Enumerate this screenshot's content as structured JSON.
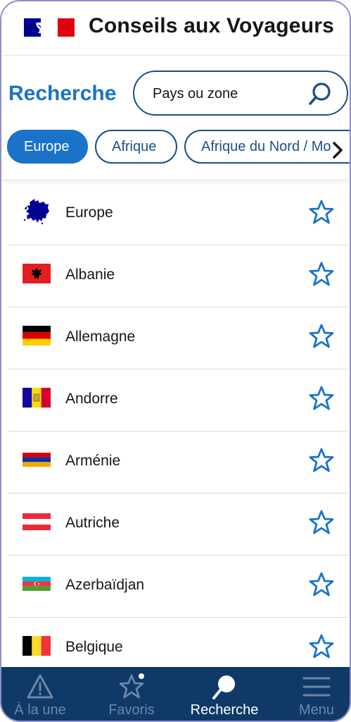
{
  "header": {
    "title": "Conseils aux Voyageurs",
    "colors": {
      "blue": "#000091",
      "red": "#e1000f"
    }
  },
  "search": {
    "heading": "Recherche",
    "placeholder": "Pays ou zone",
    "value": ""
  },
  "chips": [
    {
      "label": "Europe",
      "active": true
    },
    {
      "label": "Afrique",
      "active": false
    },
    {
      "label": "Afrique du Nord / Mo",
      "active": false
    }
  ],
  "countries": [
    {
      "name": "Europe",
      "flag": "europe-map",
      "favorite": false
    },
    {
      "name": "Albanie",
      "flag": "albania-flag",
      "favorite": false
    },
    {
      "name": "Allemagne",
      "flag": "germany-flag",
      "favorite": false
    },
    {
      "name": "Andorre",
      "flag": "andorra-flag",
      "favorite": false
    },
    {
      "name": "Arménie",
      "flag": "armenia-flag",
      "favorite": false
    },
    {
      "name": "Autriche",
      "flag": "austria-flag",
      "favorite": false
    },
    {
      "name": "Azerbaïdjan",
      "flag": "azerbaijan-flag",
      "favorite": false
    },
    {
      "name": "Belgique",
      "flag": "belgium-flag",
      "favorite": false
    }
  ],
  "bottom_nav": [
    {
      "label": "À la une",
      "icon": "warning-icon",
      "active": false
    },
    {
      "label": "Favoris",
      "icon": "star-icon",
      "active": false,
      "dot": true
    },
    {
      "label": "Recherche",
      "icon": "search-icon",
      "active": true
    },
    {
      "label": "Menu",
      "icon": "menu-icon",
      "active": false
    }
  ],
  "theme": {
    "accent": "#1a73c8",
    "dark_blue": "#1b4f8a",
    "nav_bg": "#0f3a68"
  }
}
